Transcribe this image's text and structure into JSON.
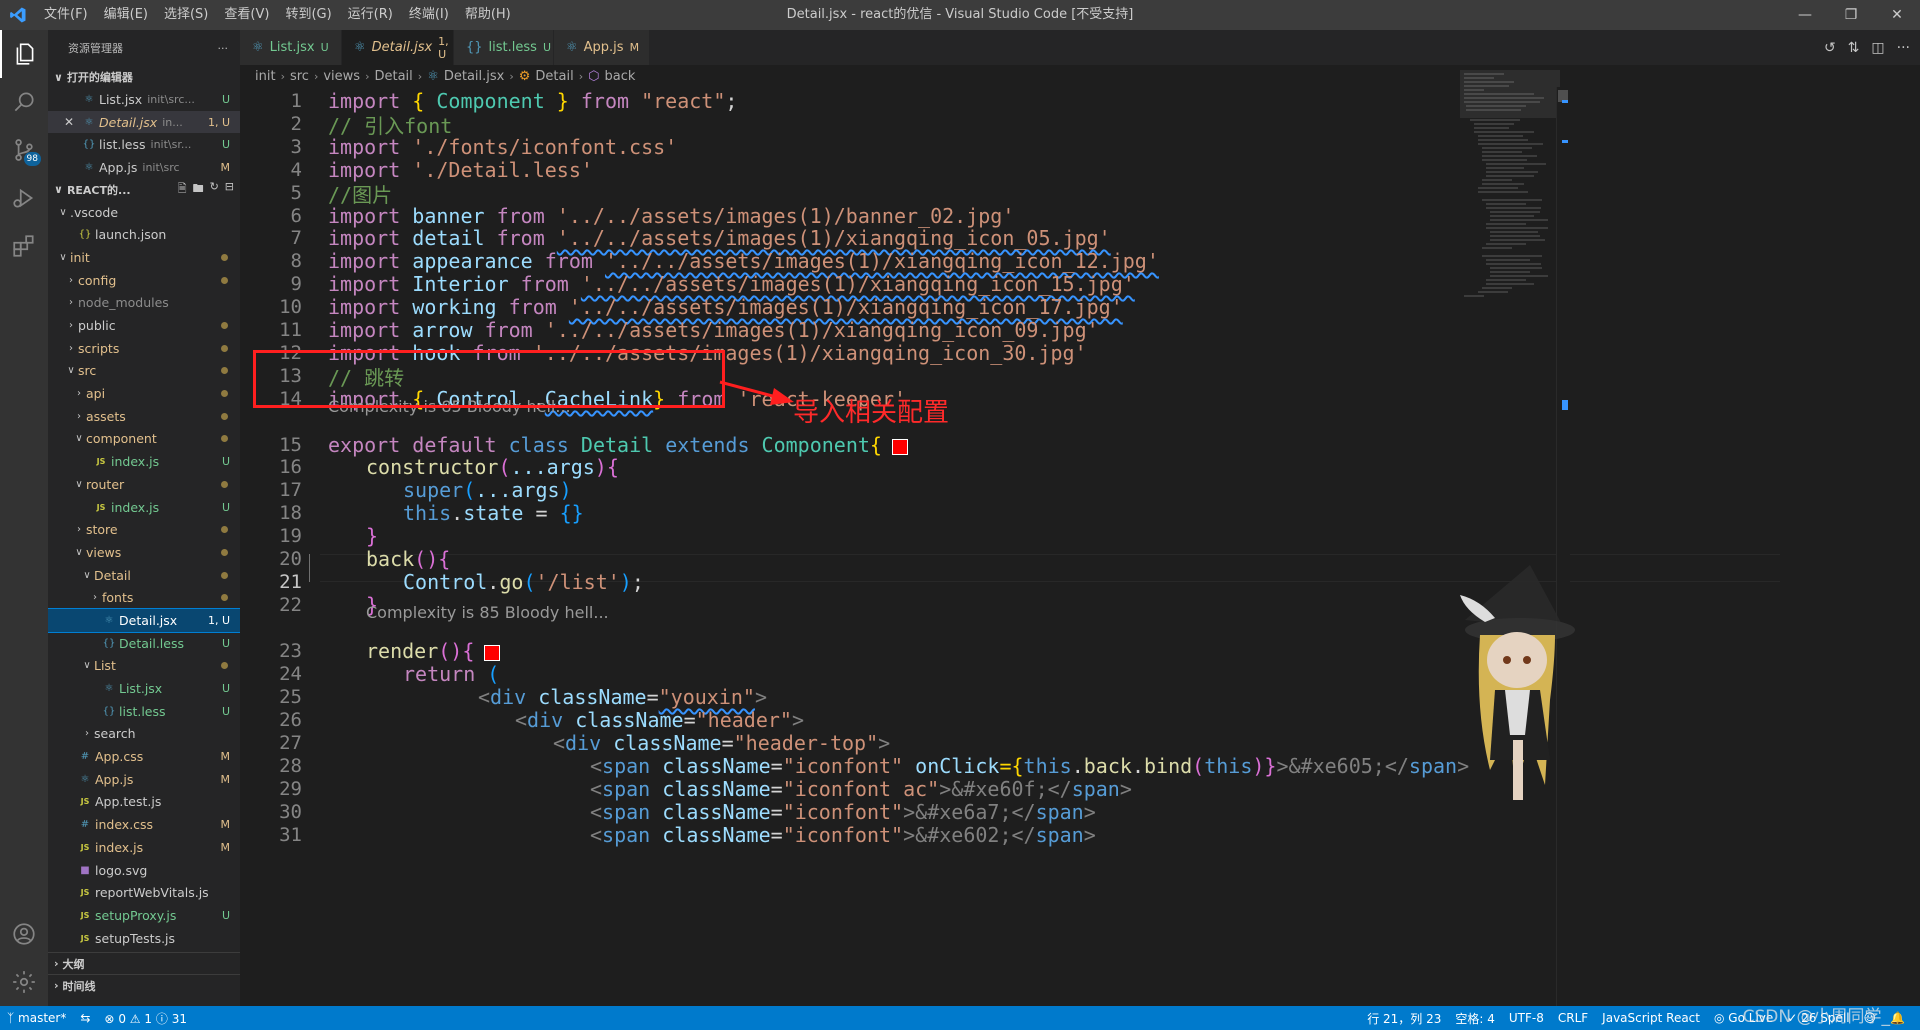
{
  "titlebar": {
    "menu": [
      "文件(F)",
      "编辑(E)",
      "选择(S)",
      "查看(V)",
      "转到(G)",
      "运行(R)",
      "终端(I)",
      "帮助(H)"
    ],
    "window_title": "Detail.jsx - react的优信 - Visual Studio Code [不受支持]"
  },
  "activity": {
    "scm_badge": "98"
  },
  "sidebar": {
    "title": "资源管理器",
    "open_editors_label": "打开的编辑器",
    "open_editors": [
      {
        "name": "List.jsx",
        "desc": "init\\src...",
        "status": "U"
      },
      {
        "name": "Detail.jsx",
        "desc": "in...",
        "status": "1, U"
      },
      {
        "name": "list.less",
        "desc": "init\\sr...",
        "status": "U"
      },
      {
        "name": "App.js",
        "desc": "init\\src",
        "status": "M"
      }
    ],
    "project_label": "REACT的...",
    "tree": [
      {
        "name": ".vscode"
      },
      {
        "name": "launch.json"
      },
      {
        "name": "init"
      },
      {
        "name": "config"
      },
      {
        "name": "node_modules"
      },
      {
        "name": "public"
      },
      {
        "name": "scripts"
      },
      {
        "name": "src"
      },
      {
        "name": "api"
      },
      {
        "name": "assets"
      },
      {
        "name": "component"
      },
      {
        "name": "index.js",
        "status": "U"
      },
      {
        "name": "router"
      },
      {
        "name": "index.js",
        "status": "U"
      },
      {
        "name": "store"
      },
      {
        "name": "views"
      },
      {
        "name": "Detail"
      },
      {
        "name": "fonts"
      },
      {
        "name": "Detail.jsx",
        "status": "1, U"
      },
      {
        "name": "Detail.less",
        "status": "U"
      },
      {
        "name": "List"
      },
      {
        "name": "List.jsx",
        "status": "U"
      },
      {
        "name": "list.less",
        "status": "U"
      },
      {
        "name": "search"
      },
      {
        "name": "App.css",
        "status": "M"
      },
      {
        "name": "App.js",
        "status": "M"
      },
      {
        "name": "App.test.js"
      },
      {
        "name": "index.css",
        "status": "M"
      },
      {
        "name": "index.js",
        "status": "M"
      },
      {
        "name": "logo.svg"
      },
      {
        "name": "reportWebVitals.js"
      },
      {
        "name": "setupProxy.js",
        "status": "U"
      },
      {
        "name": "setupTests.js"
      }
    ],
    "outline_label": "大纲",
    "timeline_label": "时间线"
  },
  "tabs": [
    {
      "name": "List.jsx",
      "status": "U"
    },
    {
      "name": "Detail.jsx",
      "status": "1, U"
    },
    {
      "name": "list.less",
      "status": "U"
    },
    {
      "name": "App.js",
      "status": "M"
    }
  ],
  "breadcrumb": [
    "init",
    "src",
    "views",
    "Detail",
    "Detail.jsx",
    "Detail",
    "back"
  ],
  "editor": {
    "line_numbers": [
      "1",
      "2",
      "3",
      "4",
      "5",
      "6",
      "7",
      "8",
      "9",
      "10",
      "11",
      "12",
      "13",
      "14",
      "15",
      "16",
      "17",
      "18",
      "19",
      "20",
      "21",
      "22",
      "23",
      "24",
      "25",
      "26",
      "27",
      "28",
      "29",
      "30",
      "31"
    ],
    "current_line": "21",
    "codelens_1": "Complexity is 85 Bloody hell...",
    "codelens_2": "Complexity is 85 Bloody hell...",
    "code": {
      "l1": [
        "import",
        " { ",
        "Component",
        " } ",
        "from",
        " ",
        "\"react\"",
        ";"
      ],
      "l2": "// 引入font",
      "l3": [
        "import",
        " ",
        "'./fonts/iconfont.css'"
      ],
      "l4": [
        "import",
        " ",
        "'./Detail.less'"
      ],
      "l5": "//图片",
      "l6": [
        "import",
        " ",
        "banner",
        " ",
        "from",
        " ",
        "'../../assets/images(1)/banner_02.jpg'"
      ],
      "l7": [
        "import",
        " ",
        "detail",
        " ",
        "from",
        " ",
        "'../../assets/images(1)/xiangqing_icon_05.jpg'"
      ],
      "l8": [
        "import",
        " ",
        "appearance",
        " ",
        "from",
        " ",
        "'../../assets/images(1)/xiangqing_icon_12.jpg'"
      ],
      "l9": [
        "import",
        " ",
        "Interior",
        " ",
        "from",
        " ",
        "'../../assets/images(1)/xiangqing_icon_15.jpg'"
      ],
      "l10": [
        "import",
        " ",
        "working",
        " ",
        "from",
        " ",
        "'../../assets/images(1)/xiangqing_icon_17.jpg'"
      ],
      "l11": [
        "import",
        " ",
        "arrow",
        " ",
        "from",
        " ",
        "'../../assets/images(1)/xiangqing_icon_09.jpg'"
      ],
      "l12": [
        "import",
        " ",
        "hook",
        " ",
        "from",
        " ",
        "'../../assets/images(1)/xiangqing_icon_30.jpg'"
      ],
      "l13": "// 跳转",
      "l14": [
        "import",
        " { ",
        "Control",
        " ,",
        "CacheLink",
        "} ",
        "from",
        " ",
        "'react-keeper'"
      ],
      "l15": [
        "export",
        " ",
        "default",
        " ",
        "class",
        " ",
        "Detail",
        " ",
        "extends",
        " ",
        "Component",
        "{"
      ],
      "l16": [
        "constructor",
        "(",
        "...args",
        "){"
      ],
      "l17": [
        "super",
        "(",
        "...args",
        ")"
      ],
      "l18": [
        "this",
        ".",
        "state",
        " = ",
        "{}"
      ],
      "l19": "}",
      "l20": [
        "back",
        "(){"
      ],
      "l21": [
        "Control",
        ".",
        "go",
        "(",
        "'/list'",
        ")",
        ";"
      ],
      "l22": "}",
      "l23": [
        "render",
        "(){"
      ],
      "l24": [
        "return",
        " ("
      ],
      "l25": [
        "<",
        "div",
        " ",
        "className",
        "=",
        "\"youxin\"",
        ">"
      ],
      "l26": [
        "<",
        "div",
        " ",
        "className",
        "=",
        "\"header\"",
        ">"
      ],
      "l27": [
        "<",
        "div",
        " ",
        "className",
        "=",
        "\"header-top\"",
        ">"
      ],
      "l28": [
        "<",
        "span",
        " ",
        "className",
        "=",
        "\"iconfont\"",
        " ",
        "onClick",
        "={",
        "this",
        ".",
        "back",
        ".",
        "bind",
        "(",
        "this",
        ")}",
        ">&#xe605;</",
        "span",
        ">"
      ],
      "l29": [
        "<",
        "span",
        " ",
        "className",
        "=",
        "\"iconfont ac\"",
        ">&#xe60f;</",
        "span",
        ">"
      ],
      "l30": [
        "<",
        "span",
        " ",
        "className",
        "=",
        "\"iconfont\"",
        ">&#xe6a7;</",
        "span",
        ">"
      ],
      "l31": [
        "<",
        "span",
        " ",
        "className",
        "=",
        "\"iconfont\"",
        ">&#xe602;</",
        "span",
        ">"
      ]
    }
  },
  "annotation": {
    "text": "导入相关配置",
    "color": "#ff2a2a"
  },
  "statusbar": {
    "branch": "master*",
    "errors": "0",
    "warnings": "1",
    "info": "31",
    "position": "行 21，列 23",
    "spaces": "空格: 4",
    "encoding": "UTF-8",
    "eol": "CRLF",
    "language": "JavaScript React",
    "golive": "Go Live",
    "spell": "26 Spell",
    "watermark": "CSDN @小周同学_"
  },
  "colors": {
    "accent": "#007acc",
    "keyword": "#c586c0",
    "string": "#ce9178",
    "comment": "#6a9955",
    "annotation_red": "#ff1f1f"
  }
}
